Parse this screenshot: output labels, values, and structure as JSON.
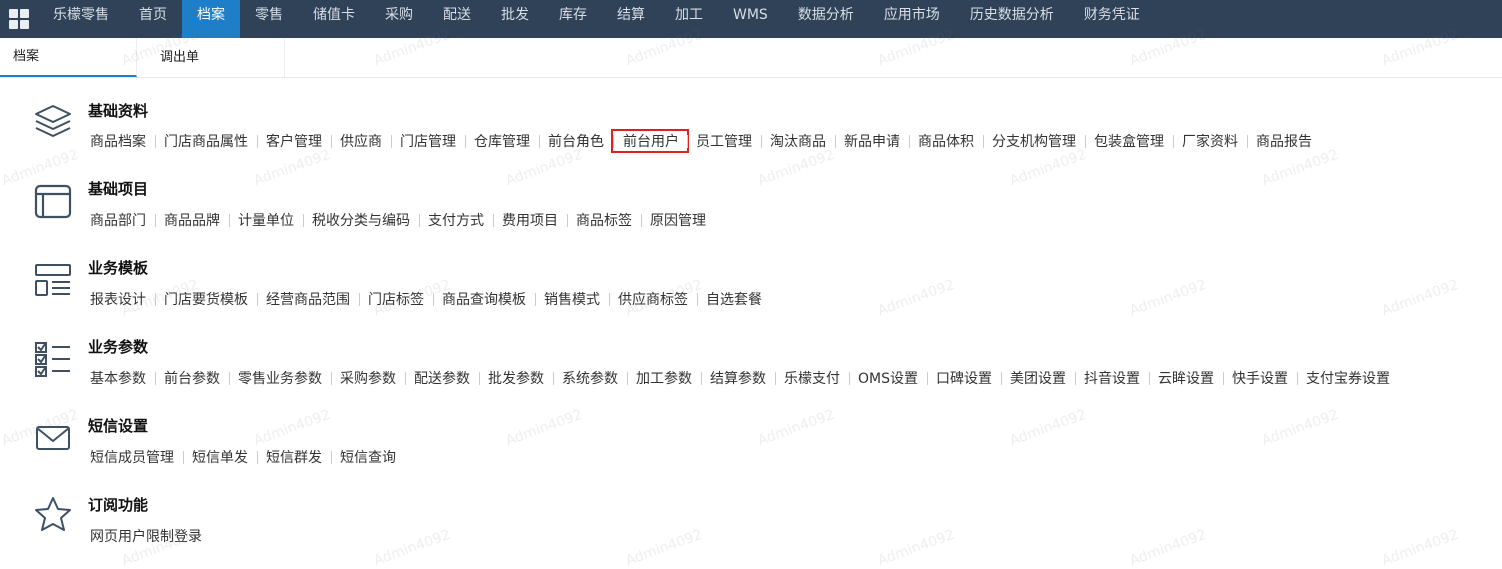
{
  "topnav": {
    "items": [
      "乐檬零售",
      "首页",
      "档案",
      "零售",
      "储值卡",
      "采购",
      "配送",
      "批发",
      "库存",
      "结算",
      "加工",
      "WMS",
      "数据分析",
      "应用市场",
      "历史数据分析",
      "财务凭证"
    ],
    "active": "档案"
  },
  "subtabs": [
    "档案",
    "调出单"
  ],
  "sections": [
    {
      "title": "基础资料",
      "icon": "layers-icon",
      "links": [
        "商品档案",
        "门店商品属性",
        "客户管理",
        "供应商",
        "门店管理",
        "仓库管理",
        "前台角色",
        "前台用户",
        "员工管理",
        "淘汰商品",
        "新品申请",
        "商品体积",
        "分支机构管理",
        "包装盒管理",
        "厂家资料",
        "商品报告"
      ],
      "highlight": "前台用户"
    },
    {
      "title": "基础项目",
      "icon": "window-icon",
      "links": [
        "商品部门",
        "商品品牌",
        "计量单位",
        "税收分类与编码",
        "支付方式",
        "费用项目",
        "商品标签",
        "原因管理"
      ]
    },
    {
      "title": "业务模板",
      "icon": "template-icon",
      "links": [
        "报表设计",
        "门店要货模板",
        "经营商品范围",
        "门店标签",
        "商品查询模板",
        "销售模式",
        "供应商标签",
        "自选套餐"
      ]
    },
    {
      "title": "业务参数",
      "icon": "checklist-icon",
      "links": [
        "基本参数",
        "前台参数",
        "零售业务参数",
        "采购参数",
        "配送参数",
        "批发参数",
        "系统参数",
        "加工参数",
        "结算参数",
        "乐檬支付",
        "OMS设置",
        "口碑设置",
        "美团设置",
        "抖音设置",
        "云眸设置",
        "快手设置",
        "支付宝券设置"
      ]
    },
    {
      "title": "短信设置",
      "icon": "mail-icon",
      "links": [
        "短信成员管理",
        "短信单发",
        "短信群发",
        "短信查询"
      ]
    },
    {
      "title": "订阅功能",
      "icon": "star-icon",
      "links": [
        "网页用户限制登录"
      ]
    }
  ],
  "watermark": "Admin4092",
  "colors": {
    "nav_bg": "#2f4257",
    "nav_active": "#1f7ec8",
    "highlight_border": "#e02020"
  }
}
